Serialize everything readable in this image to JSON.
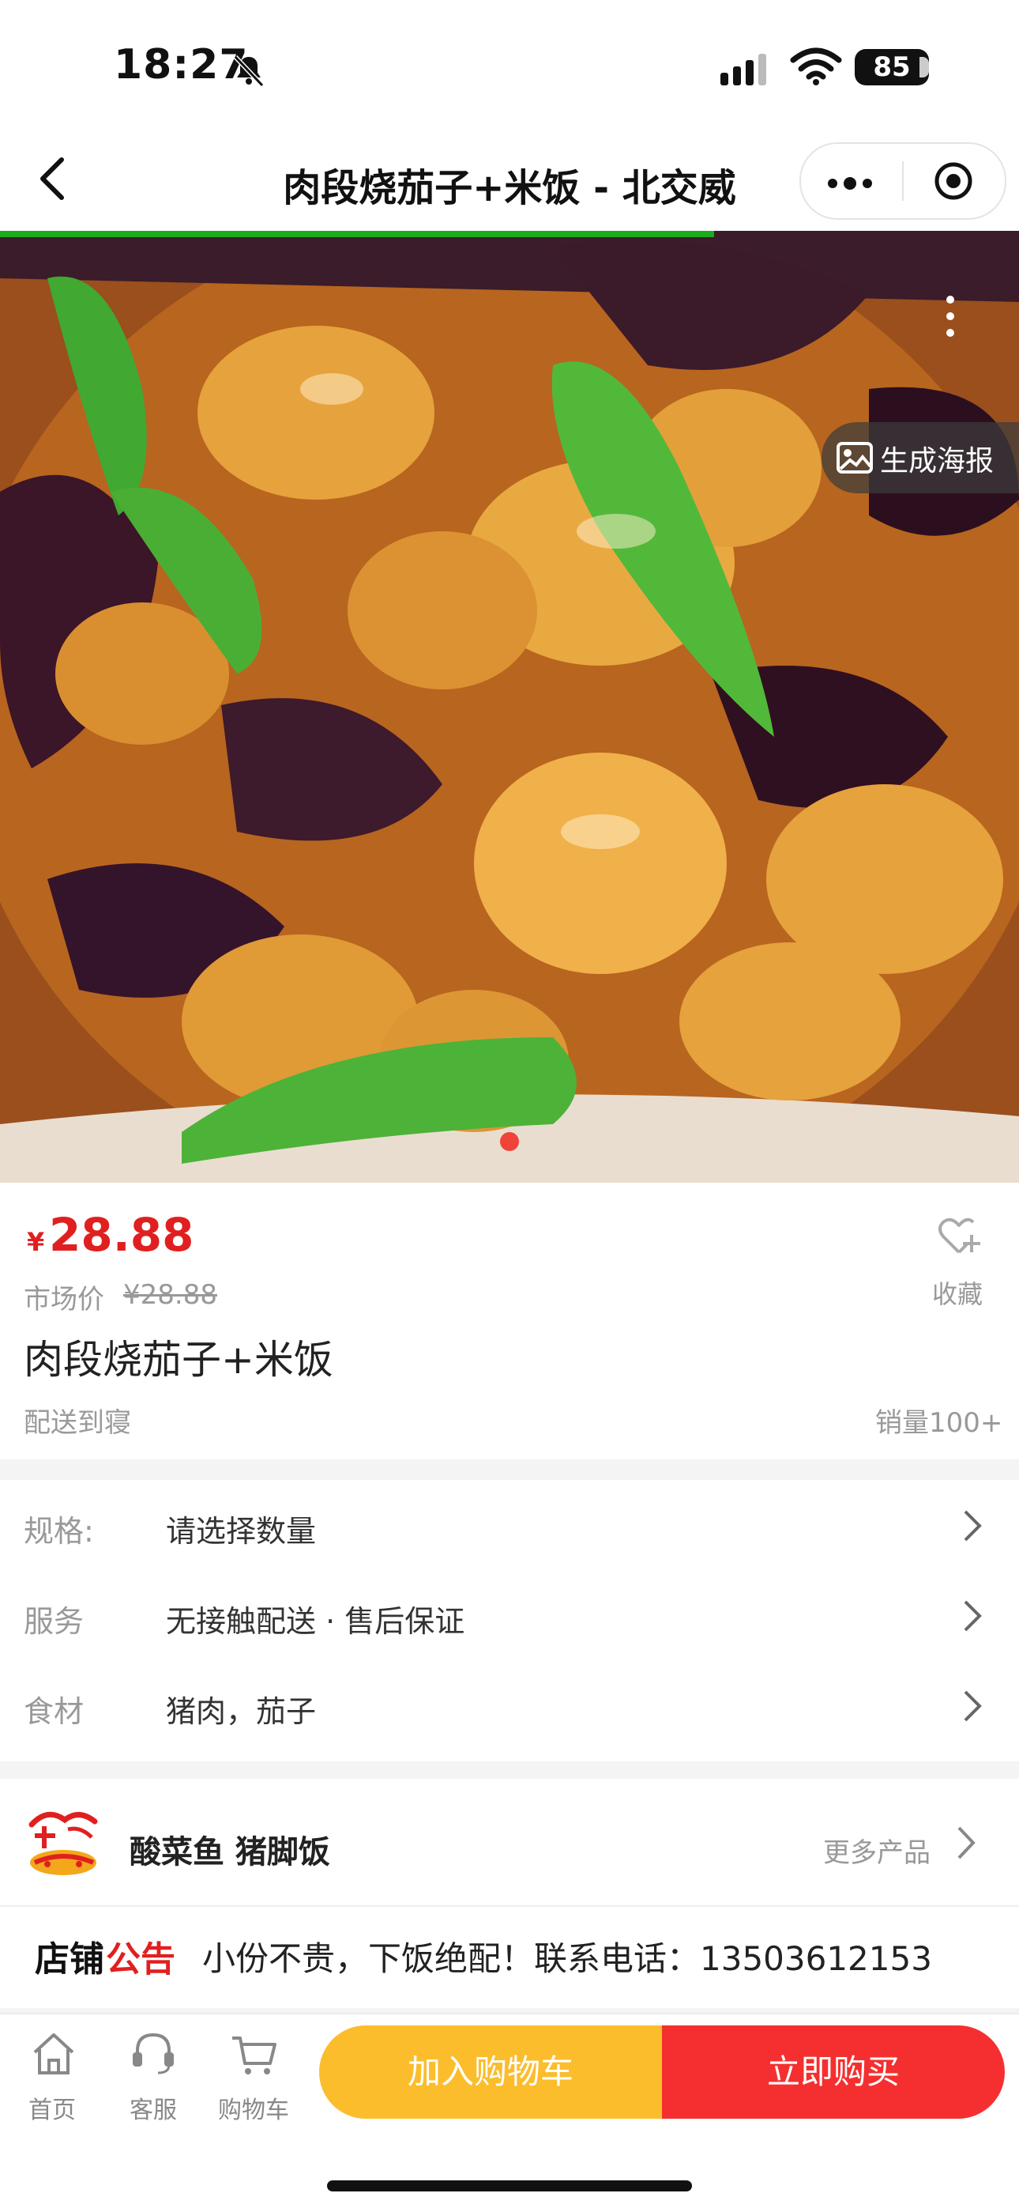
{
  "status_bar": {
    "time": "18:27",
    "battery": "85"
  },
  "nav": {
    "title": "肉段烧茄子+米饭 - 北交威"
  },
  "hero": {
    "poster_label": "生成海报"
  },
  "product": {
    "currency": "¥",
    "price": "28.88",
    "market_label": "市场价",
    "market_price": "¥28.88",
    "favorite_label": "收藏",
    "name": "肉段烧茄子+米饭",
    "delivery": "配送到寝",
    "sales": "销量100+"
  },
  "specs": [
    {
      "label": "规格:",
      "value": "请选择数量"
    },
    {
      "label": "服务",
      "value": "无接触配送 · 售后保证"
    },
    {
      "label": "食材",
      "value": "猪肉，茄子"
    }
  ],
  "shop": {
    "name": "酸菜鱼 猪脚饭",
    "more": "更多产品"
  },
  "notice": {
    "label_a": "店铺",
    "label_b": "公告",
    "text": "小份不贵，下饭绝配！联系电话：13503612153"
  },
  "bottom": {
    "tabs": [
      {
        "label": "首页",
        "icon": "home-icon"
      },
      {
        "label": "客服",
        "icon": "headset-icon"
      },
      {
        "label": "购物车",
        "icon": "cart-icon"
      }
    ],
    "add_to_cart": "加入购物车",
    "buy_now": "立即购买"
  },
  "colors": {
    "price_red": "#e02020",
    "cart_yellow": "#fbbd2c",
    "buy_red": "#f52f2f",
    "progress_green": "#1aad19"
  }
}
